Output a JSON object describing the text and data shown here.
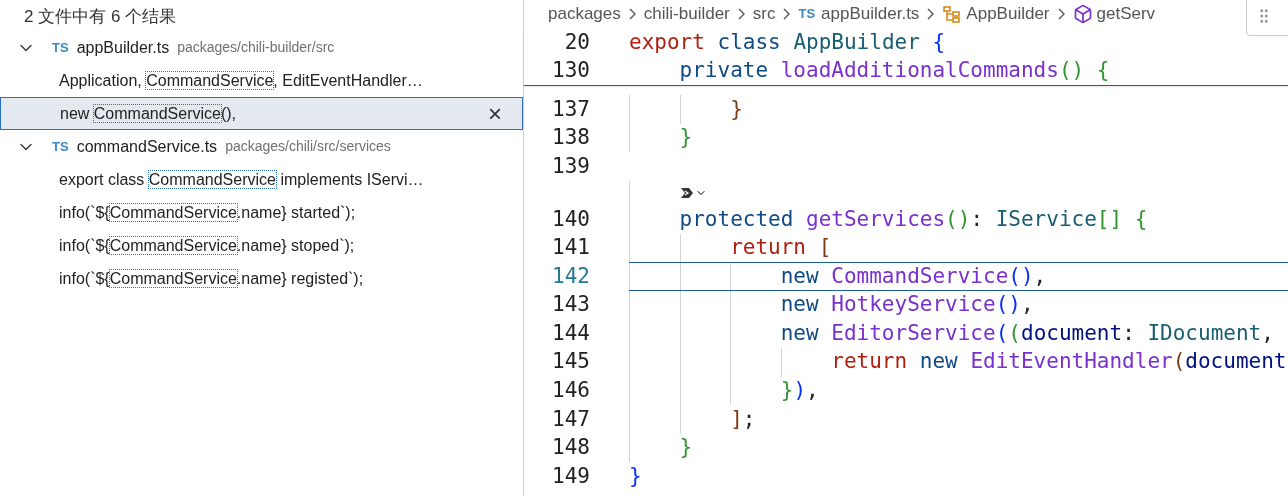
{
  "search": {
    "summary": "2 文件中有 6 个结果",
    "files": [
      {
        "name": "appBuilder.ts",
        "badge": "TS",
        "path": "packages/chili-builder/src",
        "expanded": true,
        "matches": [
          {
            "before": "Application, ",
            "match": "CommandService",
            "after": ", EditEventHandler…",
            "selected": false
          },
          {
            "before": "new ",
            "match": "CommandService",
            "after": "(),",
            "selected": true,
            "dismiss": "×"
          }
        ]
      },
      {
        "name": "commandService.ts",
        "badge": "TS",
        "path": "packages/chili/src/services",
        "expanded": true,
        "matches": [
          {
            "before": "export class ",
            "match": "CommandService",
            "after": " implements IServi…",
            "selected": false
          },
          {
            "before": "info(`${",
            "match": "CommandService",
            "after": ".name} started`);",
            "selected": false
          },
          {
            "before": "info(`${",
            "match": "CommandService",
            "after": ".name} stoped`);",
            "selected": false
          },
          {
            "before": "info(`${",
            "match": "CommandService",
            "after": ".name} registed`);",
            "selected": false
          }
        ]
      }
    ]
  },
  "breadcrumb": [
    {
      "kind": "folder",
      "text": "packages"
    },
    {
      "kind": "folder",
      "text": "chili-builder"
    },
    {
      "kind": "folder",
      "text": "src"
    },
    {
      "kind": "file",
      "badge": "TS",
      "text": "appBuilder.ts"
    },
    {
      "kind": "class",
      "text": "AppBuilder"
    },
    {
      "kind": "method",
      "text": "getServ"
    }
  ],
  "sticky": [
    {
      "number": "20",
      "tokens": [
        {
          "kind": "control",
          "text": "export "
        },
        {
          "kind": "storage",
          "text": "class "
        },
        {
          "kind": "type",
          "text": "AppBuilder "
        },
        {
          "kind": "b1",
          "text": "{"
        }
      ]
    },
    {
      "number": "130",
      "tokens": [
        {
          "kind": "storage",
          "text": "    private "
        },
        {
          "kind": "func",
          "text": "loadAdditionalCommands"
        },
        {
          "kind": "b2",
          "text": "() {"
        }
      ]
    }
  ],
  "lines": [
    {
      "number": "137",
      "current": false,
      "tokens": [
        {
          "kind": "b3",
          "text": "        }"
        }
      ]
    },
    {
      "number": "138",
      "current": false,
      "tokens": [
        {
          "kind": "b2",
          "text": "    }"
        }
      ]
    },
    {
      "number": "139",
      "current": false
    },
    {
      "kind": "codelens"
    },
    {
      "number": "140",
      "current": false,
      "tokens": [
        {
          "kind": "storage",
          "text": "    protected "
        },
        {
          "kind": "func",
          "text": "getServices"
        },
        {
          "kind": "b2",
          "text": "()"
        },
        {
          "kind": "plain",
          "text": ": "
        },
        {
          "kind": "type",
          "text": "IService"
        },
        {
          "kind": "b2",
          "text": "[] {"
        }
      ]
    },
    {
      "number": "141",
      "current": false,
      "tokens": [
        {
          "kind": "control",
          "text": "        return "
        },
        {
          "kind": "b3",
          "text": "["
        }
      ]
    },
    {
      "number": "142",
      "current": true,
      "tokens": [
        {
          "kind": "storage",
          "text": "            new "
        },
        {
          "kind": "func",
          "text": "CommandService"
        },
        {
          "kind": "b1",
          "text": "()"
        },
        {
          "kind": "plain",
          "text": ","
        }
      ]
    },
    {
      "number": "143",
      "current": false,
      "tokens": [
        {
          "kind": "storage",
          "text": "            new "
        },
        {
          "kind": "func",
          "text": "HotkeyService"
        },
        {
          "kind": "b1",
          "text": "()"
        },
        {
          "kind": "plain",
          "text": ","
        }
      ]
    },
    {
      "number": "144",
      "current": false,
      "tokens": [
        {
          "kind": "storage",
          "text": "            new "
        },
        {
          "kind": "func",
          "text": "EditorService"
        },
        {
          "kind": "b1",
          "text": "("
        },
        {
          "kind": "b2",
          "text": "("
        },
        {
          "kind": "var",
          "text": "document"
        },
        {
          "kind": "plain",
          "text": ": "
        },
        {
          "kind": "type",
          "text": "IDocument"
        },
        {
          "kind": "plain",
          "text": ","
        }
      ]
    },
    {
      "number": "145",
      "current": false,
      "tokens": [
        {
          "kind": "control",
          "text": "                return "
        },
        {
          "kind": "storage",
          "text": "new "
        },
        {
          "kind": "func",
          "text": "EditEventHandler"
        },
        {
          "kind": "b3",
          "text": "("
        },
        {
          "kind": "var",
          "text": "document"
        }
      ]
    },
    {
      "number": "146",
      "current": false,
      "tokens": [
        {
          "kind": "b2",
          "text": "            }"
        },
        {
          "kind": "b1",
          "text": ")"
        },
        {
          "kind": "plain",
          "text": ","
        }
      ]
    },
    {
      "number": "147",
      "current": false,
      "tokens": [
        {
          "kind": "b3",
          "text": "        ]"
        },
        {
          "kind": "plain",
          "text": ";"
        }
      ]
    },
    {
      "number": "148",
      "current": false,
      "tokens": [
        {
          "kind": "b2",
          "text": "    }"
        }
      ]
    },
    {
      "number": "149",
      "current": false,
      "tokens": [
        {
          "kind": "b1",
          "text": "}"
        }
      ]
    }
  ]
}
